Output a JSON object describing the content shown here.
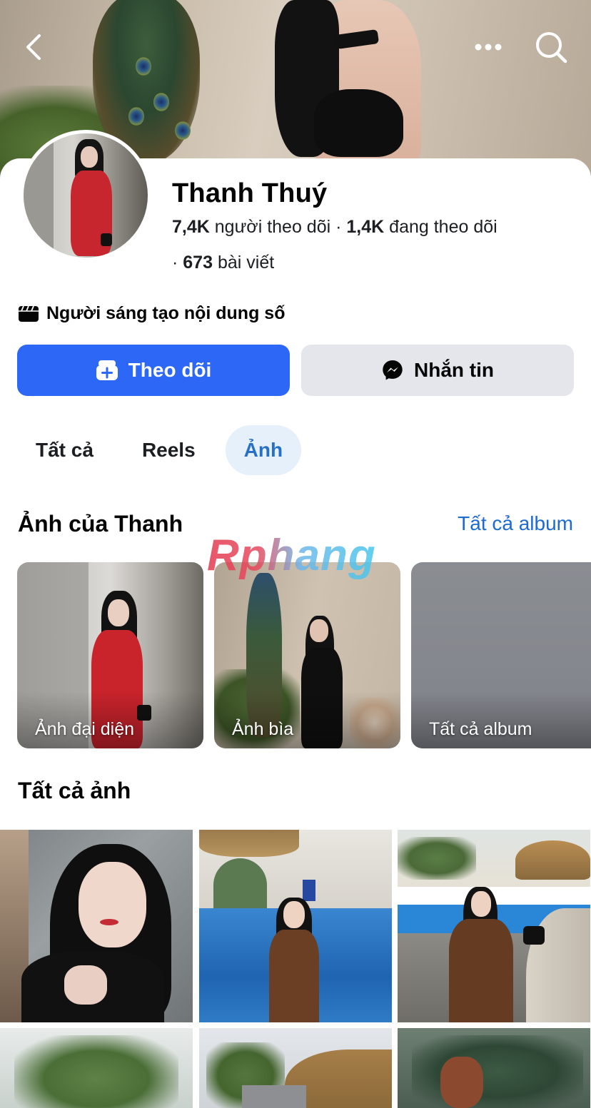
{
  "nav": {
    "back_icon": "chevron-left-icon",
    "more_icon": "more-horizontal-icon",
    "search_icon": "search-icon"
  },
  "profile": {
    "name": "Thanh Thuý",
    "followers_count": "7,4K",
    "followers_label": "người theo dõi",
    "following_count": "1,4K",
    "following_label": "đang theo dõi",
    "posts_count": "673",
    "posts_label": "bài viết",
    "category": "Người sáng tạo nội dung số",
    "category_icon": "clapperboard-icon"
  },
  "actions": {
    "follow_label": "Theo dõi",
    "follow_icon": "add-friend-icon",
    "message_label": "Nhắn tin",
    "message_icon": "messenger-icon"
  },
  "tabs": [
    {
      "label": "Tất cả",
      "active": false
    },
    {
      "label": "Reels",
      "active": false
    },
    {
      "label": "Ảnh",
      "active": true
    }
  ],
  "photos_section": {
    "title": "Ảnh của Thanh",
    "all_albums_link": "Tất cả album",
    "albums": [
      {
        "label": "Ảnh đại diện"
      },
      {
        "label": "Ảnh bìa"
      },
      {
        "label": "Tất cả album"
      }
    ]
  },
  "all_photos": {
    "title": "Tất cả ảnh"
  },
  "watermark": "Rphang",
  "colors": {
    "primary": "#2d67f5",
    "secondary_button": "#e4e6eb",
    "tab_active_bg": "#e6f0fb",
    "tab_active_text": "#2770c8",
    "link": "#1d6ad1"
  }
}
